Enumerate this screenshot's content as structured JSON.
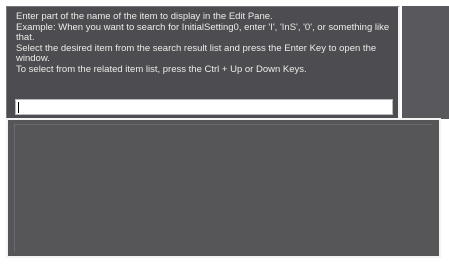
{
  "search_panel": {
    "instructions": [
      "Enter part of the name of the item to display in the Edit Pane.",
      "Example: When you want to search for InitialSetting0, enter 'I', 'InS', '0', or something like that.",
      "Select the desired item from the search result list and press the Enter Key to open the window.",
      "To select from the related item list, press the Ctrl + Up or Down Keys."
    ],
    "search_value": ""
  },
  "results": {
    "items": []
  }
}
